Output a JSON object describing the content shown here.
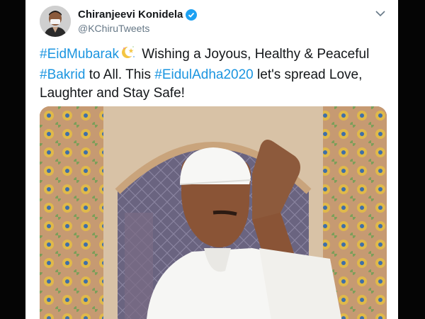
{
  "author": {
    "name": "Chiranjeevi Konidela",
    "handle": "@KChiruTweets",
    "verified": true
  },
  "tweet": {
    "segments": [
      {
        "type": "hashtag",
        "text": "#EidMubarak"
      },
      {
        "type": "emoji",
        "icon": "crescent-star-icon"
      },
      {
        "type": "text",
        "text": " Wishing a Joyous, Healthy & Peaceful "
      },
      {
        "type": "hashtag",
        "text": "#Bakrid"
      },
      {
        "type": "text",
        "text": " to All. This "
      },
      {
        "type": "hashtag",
        "text": "#EidulAdha2020"
      },
      {
        "type": "text",
        "text": " let's spread Love, Laughter and Stay Safe!"
      }
    ]
  },
  "media": {
    "description_icon": "photo-icon"
  },
  "colors": {
    "hashtag": "#1b95e0",
    "verified": "#1da1f2",
    "text": "#14171a",
    "secondary": "#657786"
  }
}
